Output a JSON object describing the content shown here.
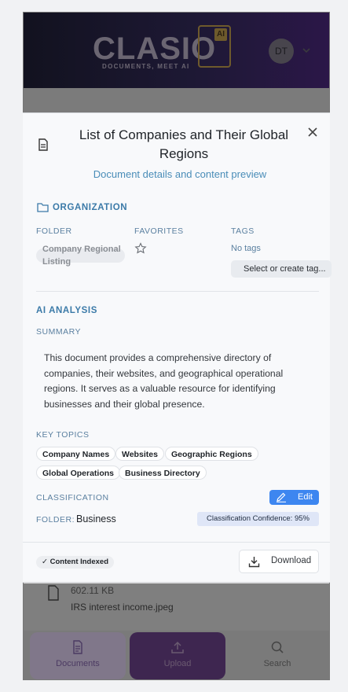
{
  "app": {
    "logo_text": "CLASIO",
    "logo_tagline": "DOCUMENTS, MEET AI",
    "logo_badge": "AI",
    "avatar_initials": "DT"
  },
  "background": {
    "file_size": "602.11 KB",
    "file_name": "IRS interest income.jpeg",
    "nav": [
      {
        "label": "Documents",
        "icon": "document-icon"
      },
      {
        "label": "Upload",
        "icon": "upload-icon"
      },
      {
        "label": "Search",
        "icon": "search-icon"
      }
    ]
  },
  "modal": {
    "title": "List of Companies and Their Global Regions",
    "subtitle": "Document details and content preview",
    "organization": {
      "heading": "ORGANIZATION",
      "folder_label": "FOLDER",
      "folder_value": "Company Regional Listing",
      "favorites_label": "FAVORITES",
      "tags_label": "TAGS",
      "tags_value": "No tags",
      "tag_select_placeholder": "Select or create tag..."
    },
    "ai_analysis": {
      "heading": "AI ANALYSIS",
      "summary_label": "SUMMARY",
      "summary": "This document provides a comprehensive directory of companies, their websites, and geographical operational regions. It serves as a valuable resource for identifying businesses and their global presence.",
      "key_topics_label": "KEY TOPICS",
      "key_topics": [
        "Company Names",
        "Websites",
        "Geographic Regions",
        "Global Operations",
        "Business Directory"
      ],
      "classification_label": "CLASSIFICATION",
      "edit_label": "Edit",
      "folder_key": "FOLDER:",
      "folder_value": "Business",
      "confidence": "Classification Confidence: 95%"
    },
    "footer": {
      "indexed_badge": "✓ Content Indexed",
      "download_label": "Download"
    }
  },
  "colors": {
    "accent": "#3b7aa8",
    "edit_button": "#3d86f0",
    "confidence_bg": "#dfe6f7"
  }
}
